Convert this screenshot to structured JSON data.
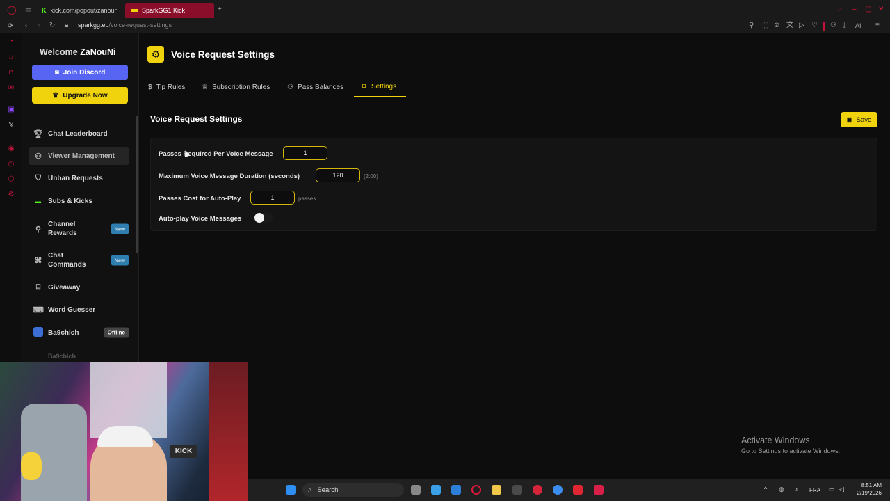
{
  "browser": {
    "tabs": [
      {
        "label": "kick.com/popout/zanouni/",
        "active": false
      },
      {
        "label": "SparkGG1 Kick",
        "active": true
      }
    ],
    "address": {
      "domain": "sparkgg.eu",
      "path": "/voice-request-settings"
    },
    "ai_label": "AI"
  },
  "sidebar": {
    "welcome_prefix": "Welcome",
    "username": "ZaNouNi",
    "join_discord": "Join Discord",
    "upgrade": "Upgrade Now",
    "items": [
      {
        "label": "Chat Leaderboard",
        "icon": "trophy-icon"
      },
      {
        "label": "Viewer Management",
        "icon": "users-icon",
        "active": true
      },
      {
        "label": "Unban Requests",
        "icon": "shield-icon"
      },
      {
        "label": "Subs & Kicks",
        "icon": "kick-icon"
      },
      {
        "label": "Channel Rewards",
        "icon": "gift-icon",
        "badge": "New"
      },
      {
        "label": "Chat Commands",
        "icon": "command-icon",
        "badge": "New"
      },
      {
        "label": "Giveaway",
        "icon": "gift-icon"
      },
      {
        "label": "Word Guesser",
        "icon": "keyboard-icon"
      },
      {
        "label": "Ba9chich",
        "icon": "avatar",
        "badge": "Offline"
      },
      {
        "label": "Ba9chich"
      }
    ]
  },
  "main": {
    "title": "Voice Request Settings",
    "tabs": [
      {
        "label": "Tip Rules",
        "icon": "dollar-icon"
      },
      {
        "label": "Subscription Rules",
        "icon": "crown-icon"
      },
      {
        "label": "Pass Balances",
        "icon": "user-icon"
      },
      {
        "label": "Settings",
        "icon": "gear-icon",
        "active": true
      }
    ],
    "section_title": "Voice Request Settings",
    "save": "Save",
    "fields": {
      "passes_required": {
        "label": "Passes Required Per Voice Message",
        "value": "1"
      },
      "max_duration": {
        "label": "Maximum Voice Message Duration (seconds)",
        "value": "120",
        "hint": "(2:00)"
      },
      "autoplay_cost": {
        "label": "Passes Cost for Auto-Play",
        "value": "1",
        "hint": "passes"
      },
      "autoplay": {
        "label": "Auto-play Voice Messages",
        "enabled": false
      }
    }
  },
  "watermark": {
    "line1": "Activate Windows",
    "line2": "Go to Settings to activate Windows."
  },
  "webcam": {
    "sign": "KICK"
  },
  "taskbar": {
    "search": "Search",
    "lang": "FRA",
    "time": "8:51 AM",
    "date": "2/19/2026"
  },
  "colors": {
    "accent": "#f0d20d",
    "discord": "#5865f2",
    "opera": "#c2143a",
    "badge_new": "#2e7fb0"
  }
}
